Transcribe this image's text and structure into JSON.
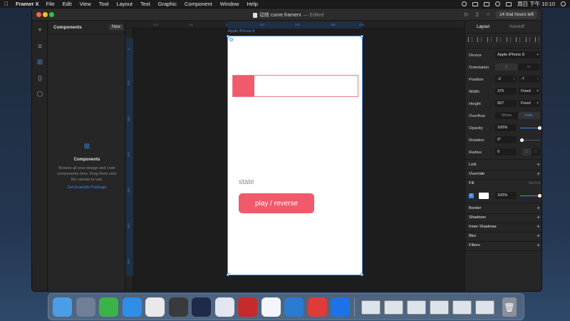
{
  "menubar": {
    "app_name": "Framer X",
    "items": [
      "File",
      "Edit",
      "View",
      "Tool",
      "Layout",
      "Text",
      "Graphic",
      "Component",
      "Window",
      "Help"
    ],
    "clock": "周日 下午 10:10"
  },
  "window": {
    "title": "动效 curve.framerx",
    "edited": "— Edited",
    "trial": "14 trial hours left"
  },
  "components_panel": {
    "title": "Components",
    "new_label": "New",
    "empty_title": "Components",
    "empty_desc": "Browse all your design and code components here. Drag them onto the canvas to use.",
    "link": "Get Example Package"
  },
  "canvas": {
    "frame_label": "Apple iPhone 8",
    "ruler_top": [
      "-100",
      "-50",
      "0",
      "100",
      "200",
      "300",
      "375"
    ],
    "ruler_left": [
      "0",
      "100",
      "200",
      "300",
      "400",
      "500",
      "600"
    ],
    "progress_fraction": 0.17,
    "state_label": "state",
    "button_label": "play / reverse",
    "accent": "#f05a6a"
  },
  "props": {
    "tab_layout": "Layout",
    "tab_handoff": "Handoff",
    "device_label": "Device",
    "device_value": "Apple iPhone 8",
    "orientation_label": "Orientation",
    "position_label": "Position",
    "position_x": "-2",
    "position_y": "-7",
    "width_label": "Width",
    "width_value": "375",
    "width_mode": "Fixed",
    "height_label": "Height",
    "height_value": "667",
    "height_mode": "Fixed",
    "overflow_label": "Overflow",
    "overflow_show": "Show",
    "overflow_hide": "Hide",
    "opacity_label": "Opacity",
    "opacity_value": "100%",
    "rotation_label": "Rotation",
    "rotation_value": "0°",
    "radius_label": "Radius",
    "radius_value": "0",
    "link_label": "Link",
    "override_label": "Override",
    "fill_label": "Fill",
    "fill_mode": "Normal",
    "fill_opacity": "100%",
    "border_label": "Border",
    "shadows_label": "Shadows",
    "inner_shadows_label": "Inner Shadows",
    "blur_label": "Blur",
    "filters_label": "Filters"
  },
  "dock": {
    "apps": [
      {
        "name": "Finder",
        "color": "#4a9ee8"
      },
      {
        "name": "Launchpad",
        "color": "#6e7f96"
      },
      {
        "name": "WeChat",
        "color": "#3cb34a"
      },
      {
        "name": "Safari",
        "color": "#2f8ee6"
      },
      {
        "name": "Chrome",
        "color": "#e9e9e9"
      },
      {
        "name": "Sublime Text",
        "color": "#3a3a3a"
      },
      {
        "name": "Cinema 4D",
        "color": "#1e2a4a"
      },
      {
        "name": "Affinity",
        "color": "#e3e6f0"
      },
      {
        "name": "Instastats",
        "color": "#c72a2a"
      },
      {
        "name": "Blue app",
        "color": "#f4f6fb"
      },
      {
        "name": "VS Code",
        "color": "#2b7bd0"
      },
      {
        "name": "NetEase Music",
        "color": "#e13a3a"
      },
      {
        "name": "Framer X",
        "color": "#1d72e8"
      }
    ]
  }
}
